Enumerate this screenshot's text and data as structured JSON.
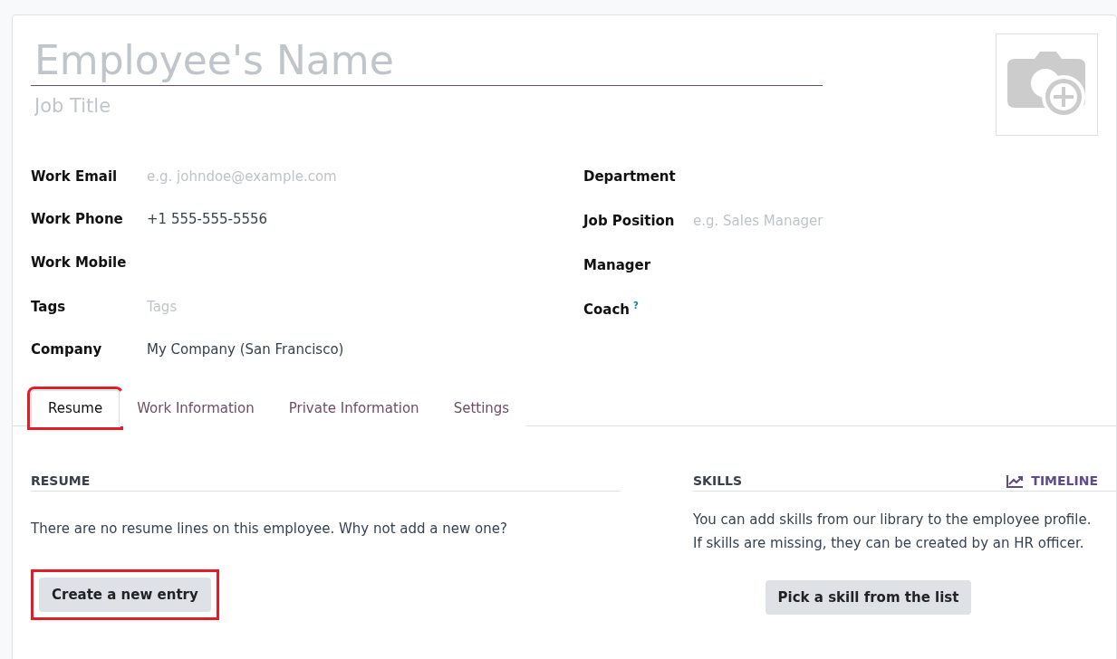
{
  "name_field": {
    "placeholder": "Employee's Name",
    "focused": true
  },
  "job_title": {
    "placeholder": "Job Title"
  },
  "left_fields": [
    {
      "label": "Work Email",
      "placeholder": "e.g. johndoe@example.com"
    },
    {
      "label": "Work Phone",
      "value": "+1 555-555-5556"
    },
    {
      "label": "Work Mobile"
    },
    {
      "label": "Tags",
      "placeholder": "Tags"
    },
    {
      "label": "Company",
      "value": "My Company (San Francisco)"
    }
  ],
  "right_fields": [
    {
      "label": "Department"
    },
    {
      "label": "Job Position",
      "placeholder": "e.g. Sales Manager"
    },
    {
      "label": "Manager"
    },
    {
      "label": "Coach",
      "help": "?"
    }
  ],
  "tabs": [
    {
      "label": "Resume",
      "selected": true,
      "highlighted": true
    },
    {
      "label": "Work Information",
      "selected": false,
      "highlighted": false
    },
    {
      "label": "Private Information",
      "selected": false,
      "highlighted": false
    },
    {
      "label": "Settings",
      "selected": false,
      "highlighted": false
    }
  ],
  "resume": {
    "heading": "RESUME",
    "message": "There are no resume lines on this employee. Why not add a new one?",
    "button": {
      "label": "Create a new entry",
      "highlighted": true
    }
  },
  "skills": {
    "heading": "SKILLS",
    "timeline": "TIMELINE",
    "message": "You can add skills from our library to the employee profile. If skills are missing, they can be created by an HR officer.",
    "button": {
      "label": "Pick a skill from the list"
    }
  }
}
